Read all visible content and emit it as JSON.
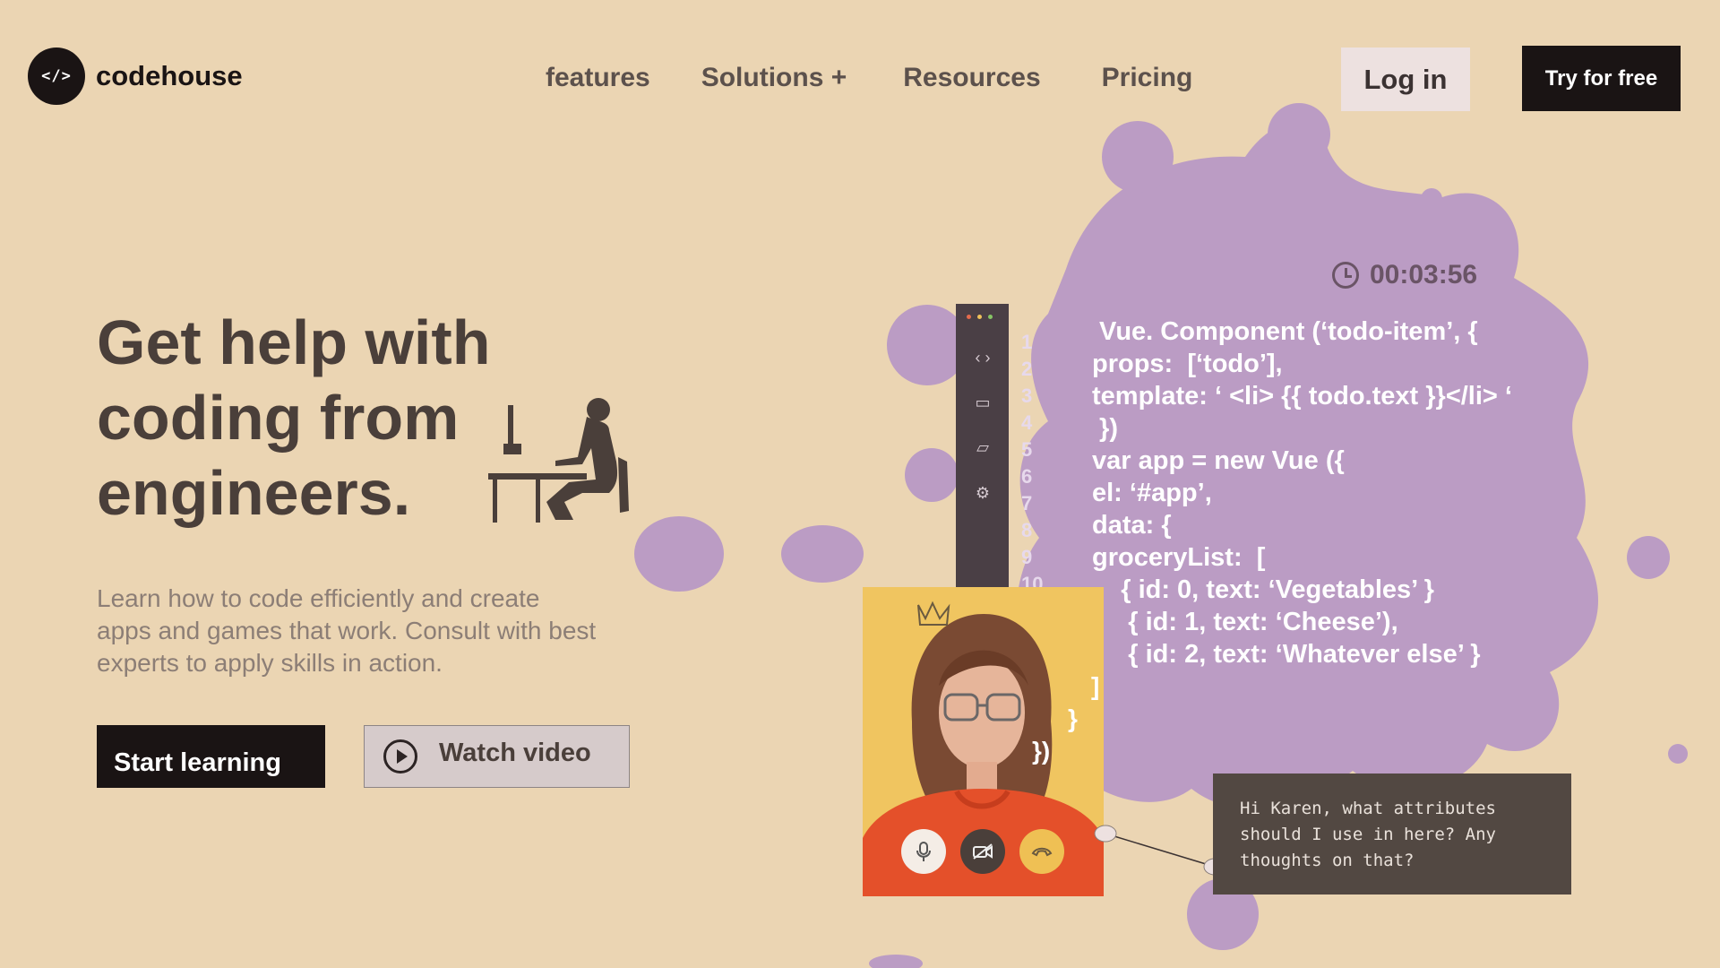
{
  "brand": {
    "logo_glyph": "</>",
    "name": "codehouse"
  },
  "nav": {
    "items": [
      {
        "label": "features"
      },
      {
        "label": "Solutions +"
      },
      {
        "label": "Resources"
      },
      {
        "label": "Pricing"
      }
    ],
    "login_label": "Log in",
    "try_label": "Try for free"
  },
  "hero": {
    "title": "Get help with coding from engineers.",
    "description": "Learn how to code efficiently and create apps and games that work. Consult with best experts to apply skills in action.",
    "start_label": "Start learning",
    "watch_label": "Watch video"
  },
  "editor": {
    "timer": "00:03:56",
    "window_dots": [
      "#e46a4c",
      "#efc15a",
      "#86c465"
    ],
    "toolbar_icons": [
      "code-icon",
      "archive-icon",
      "comment-icon",
      "settings-icon"
    ],
    "line_numbers": [
      "1",
      "2",
      "3",
      "4",
      "5",
      "6",
      "7",
      "8",
      "9",
      "10"
    ],
    "code_lines": [
      " Vue. Component (‘todo-item’, {",
      "props:  [‘todo’],",
      "template: ‘ <li> {{ todo.text }}</li> ‘",
      " })",
      "var app = new Vue ({",
      "el: ‘#app’,",
      "data: {",
      "groceryList:  [",
      "    { id: 0, text: ‘Vegetables’ }",
      "     { id: 1, text: ‘Cheese’),",
      "     { id: 2, text: ‘Whatever else’ }"
    ],
    "trailing": [
      "]",
      "}",
      "})"
    ]
  },
  "video": {
    "controls": [
      "microphone-icon",
      "camera-off-icon",
      "hang-up-icon"
    ]
  },
  "chat": {
    "message": "Hi Karen, what attributes should I use in here? Any thoughts on that?"
  },
  "colors": {
    "background": "#ebd5b3",
    "splash": "#bb9cc4",
    "dark": "#1a1414"
  }
}
